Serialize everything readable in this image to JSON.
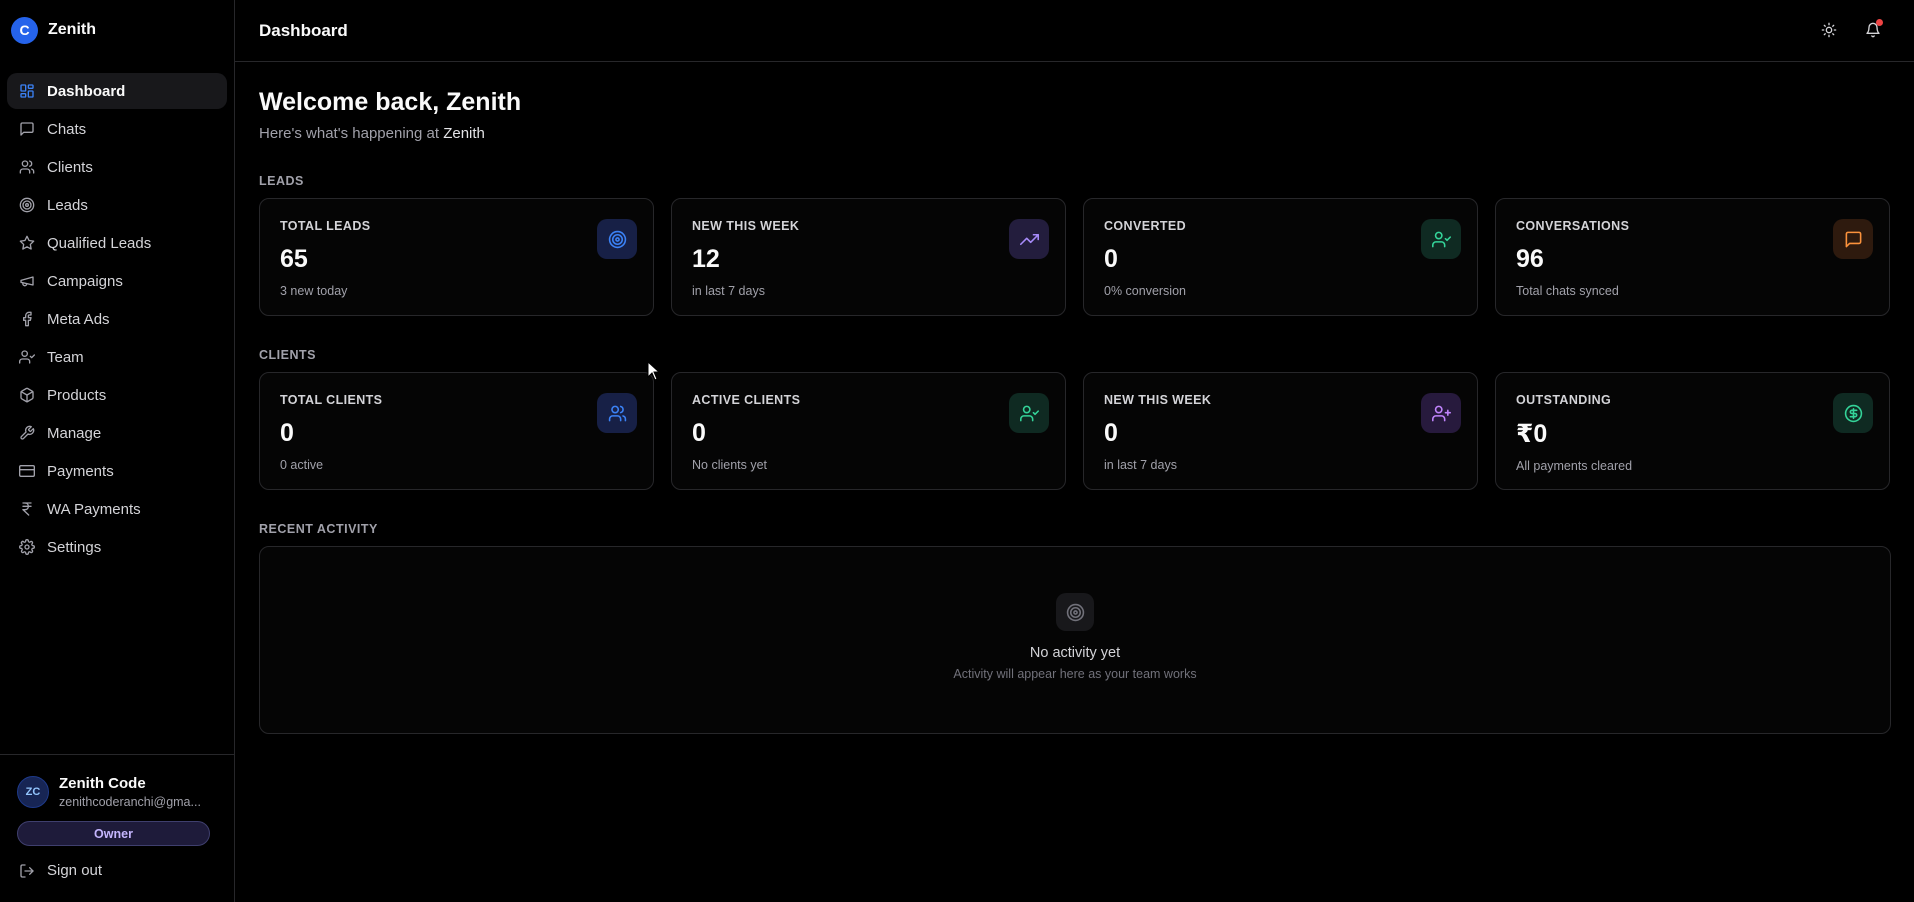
{
  "brand": {
    "initial": "C",
    "name": "Zenith",
    "color": "#2563eb"
  },
  "sidebar": {
    "items": [
      {
        "label": "Dashboard",
        "icon": "layout-grid-icon",
        "active": true
      },
      {
        "label": "Chats",
        "icon": "message-square-icon"
      },
      {
        "label": "Clients",
        "icon": "users-icon"
      },
      {
        "label": "Leads",
        "icon": "target-icon"
      },
      {
        "label": "Qualified Leads",
        "icon": "star-icon"
      },
      {
        "label": "Campaigns",
        "icon": "megaphone-icon"
      },
      {
        "label": "Meta Ads",
        "icon": "facebook-icon"
      },
      {
        "label": "Team",
        "icon": "user-check-icon"
      },
      {
        "label": "Products",
        "icon": "package-icon"
      },
      {
        "label": "Manage",
        "icon": "wrench-icon"
      },
      {
        "label": "Payments",
        "icon": "credit-card-icon"
      },
      {
        "label": "WA Payments",
        "icon": "rupee-icon"
      },
      {
        "label": "Settings",
        "icon": "gear-icon"
      }
    ]
  },
  "user": {
    "initials": "ZC",
    "name": "Zenith Code",
    "email": "zenithcoderanchi@gma...",
    "role": "Owner"
  },
  "signout_label": "Sign out",
  "header": {
    "title": "Dashboard",
    "icons": [
      "sun-icon",
      "bell-icon"
    ]
  },
  "welcome": {
    "title": "Welcome back, Zenith",
    "subtitle_prefix": "Here's what's happening at ",
    "org": "Zenith"
  },
  "leads": {
    "section_label": "LEADS",
    "cards": [
      {
        "label": "TOTAL LEADS",
        "value": "65",
        "sub": "3 new today",
        "icon": "target-icon",
        "color": "#3b82f6"
      },
      {
        "label": "NEW THIS WEEK",
        "value": "12",
        "sub": "in last 7 days",
        "icon": "trending-up-icon",
        "color": "#a78bfa"
      },
      {
        "label": "CONVERTED",
        "value": "0",
        "sub": "0% conversion",
        "icon": "user-check-icon",
        "color": "#34d399"
      },
      {
        "label": "CONVERSATIONS",
        "value": "96",
        "sub": "Total chats synced",
        "icon": "message-square-icon",
        "color": "#fb923c"
      }
    ]
  },
  "clients": {
    "section_label": "CLIENTS",
    "cards": [
      {
        "label": "TOTAL CLIENTS",
        "value": "0",
        "sub": "0 active",
        "icon": "users-icon",
        "color": "#3b82f6"
      },
      {
        "label": "ACTIVE CLIENTS",
        "value": "0",
        "sub": "No clients yet",
        "icon": "user-check-icon",
        "color": "#34d399"
      },
      {
        "label": "NEW THIS WEEK",
        "value": "0",
        "sub": "in last 7 days",
        "icon": "user-plus-icon",
        "color": "#c084fc"
      },
      {
        "label": "OUTSTANDING",
        "value": "₹0",
        "sub": "All payments cleared",
        "icon": "dollar-circle-icon",
        "color": "#34d399"
      }
    ]
  },
  "activity": {
    "section_label": "RECENT ACTIVITY",
    "empty_title": "No activity yet",
    "empty_sub": "Activity will appear here as your team works",
    "icon": "target-icon"
  }
}
